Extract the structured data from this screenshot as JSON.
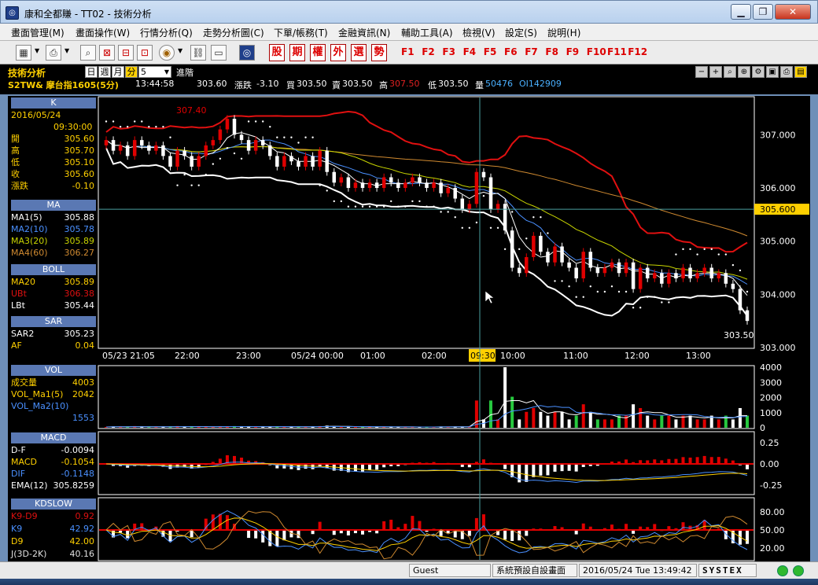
{
  "window": {
    "title": "康和全都賺 - TT02 - 技術分析",
    "min": "▁",
    "max": "❐",
    "close": "✕"
  },
  "menu": [
    "畫面管理(M)",
    "畫面操作(W)",
    "行情分析(Q)",
    "走勢分析圖(C)",
    "下單/帳務(T)",
    "金融資訊(N)",
    "輔助工具(A)",
    "檢視(V)",
    "設定(S)",
    "說明(H)"
  ],
  "toolbar": {
    "quick_buttons": [
      "股",
      "期",
      "權",
      "外",
      "選",
      "勢"
    ],
    "fkeys": [
      "F1",
      "F2",
      "F3",
      "F4",
      "F5",
      "F6",
      "F7",
      "F8",
      "F9",
      "F10",
      "F11",
      "F12"
    ]
  },
  "info": {
    "panel_title": "技術分析",
    "periods": [
      "日",
      "週",
      "月",
      "分"
    ],
    "period_value": "5",
    "advanced": "進階",
    "symbol": "S2TW& 摩台指1605(5分)",
    "time": "13:44:58",
    "price": "303.60",
    "change_label": "漲跌",
    "change": "-3.10",
    "buy_label": "買",
    "buy": "303.50",
    "sell_label": "賣",
    "sell": "303.50",
    "high_label": "高",
    "high": "307.50",
    "low_label": "低",
    "low": "303.50",
    "volume_label": "量",
    "volume": "50476",
    "oi": "OI142909"
  },
  "side": {
    "k": {
      "title": "K",
      "date": "2016/05/24",
      "time": "09:30:00",
      "rows": [
        [
          "開",
          "305.60"
        ],
        [
          "高",
          "305.70"
        ],
        [
          "低",
          "305.10"
        ],
        [
          "收",
          "305.60"
        ],
        [
          "漲跌",
          "-0.10"
        ]
      ]
    },
    "ma": {
      "title": "MA",
      "rows": [
        [
          "MA1(5)",
          "305.88"
        ],
        [
          "MA2(10)",
          "305.78"
        ],
        [
          "MA3(20)",
          "305.89"
        ],
        [
          "MA4(60)",
          "306.27"
        ]
      ]
    },
    "boll": {
      "title": "BOLL",
      "rows": [
        [
          "MA20",
          "305.89"
        ],
        [
          "UBt",
          "306.38"
        ],
        [
          "LBt",
          "305.44"
        ]
      ]
    },
    "sar": {
      "title": "SAR",
      "rows": [
        [
          "SAR2",
          "305.23"
        ],
        [
          "AF",
          "0.04"
        ]
      ]
    },
    "vol": {
      "title": "VOL",
      "rows": [
        [
          "成交量",
          "4003"
        ],
        [
          "VOL_Ma1(5)",
          "2042"
        ],
        [
          "VOL_Ma2(10)",
          ""
        ],
        [
          "",
          "1553"
        ]
      ]
    },
    "macd": {
      "title": "MACD",
      "rows": [
        [
          "D-F",
          "-0.0094"
        ],
        [
          "MACD",
          "-0.1054"
        ],
        [
          "DIF",
          "-0.1148"
        ],
        [
          "EMA(12)",
          "305.8259"
        ]
      ]
    },
    "kd": {
      "title": "KDSLOW",
      "rows": [
        [
          "K9-D9",
          "0.92"
        ],
        [
          "K9",
          "42.92"
        ],
        [
          "D9",
          "42.00"
        ],
        [
          "J(3D-2K)",
          "40.16"
        ]
      ]
    }
  },
  "colors": {
    "up": "#e00000",
    "down": "#ffffff",
    "boll_upper": "#e01010",
    "boll_lower": "#ffffff",
    "ma5": "#ffffff",
    "ma10": "#4a90ff",
    "ma20": "#c8d400",
    "ma60": "#d08a30",
    "sar": "#ffffff",
    "crosshair": "#4aa0a0",
    "accent": "#ffd000"
  },
  "chart_data": {
    "type": "candlestick",
    "price_axis": {
      "ticks": [
        "307.000",
        "306.000",
        "305.000",
        "304.000",
        "303.000"
      ],
      "ylim": [
        303.0,
        307.7
      ]
    },
    "time_labels": [
      "05/23 21:05",
      "22:00",
      "23:00",
      "05/24 00:00",
      "01:00",
      "02:00",
      "09:30",
      "10:00",
      "11:00",
      "12:00",
      "13:00"
    ],
    "crosshair_time": "09:30",
    "crosshair_price": "305.600",
    "max_label": "307.40",
    "last_label": "303.50",
    "vol_axis": {
      "ticks": [
        "4000",
        "3000",
        "2000",
        "1000",
        "0"
      ],
      "ylim": [
        0,
        4000
      ]
    },
    "macd_axis": {
      "ticks": [
        "0.25",
        "0.00",
        "-0.25"
      ],
      "ylim": [
        -0.35,
        0.35
      ]
    },
    "kd_axis": {
      "ticks": [
        "80.00",
        "50.00",
        "20.00"
      ],
      "ylim": [
        0,
        100
      ]
    },
    "candles": [
      {
        "o": 306.8,
        "c": 306.9
      },
      {
        "o": 306.9,
        "c": 306.7
      },
      {
        "o": 306.7,
        "c": 306.8
      },
      {
        "o": 306.8,
        "c": 306.6
      },
      {
        "o": 306.6,
        "c": 306.9
      },
      {
        "o": 306.9,
        "c": 306.8
      },
      {
        "o": 306.8,
        "c": 306.7
      },
      {
        "o": 306.7,
        "c": 306.8
      },
      {
        "o": 306.8,
        "c": 306.6
      },
      {
        "o": 306.6,
        "c": 306.4
      },
      {
        "o": 306.4,
        "c": 306.7
      },
      {
        "o": 306.7,
        "c": 306.6
      },
      {
        "o": 306.6,
        "c": 306.4
      },
      {
        "o": 306.4,
        "c": 306.6
      },
      {
        "o": 306.6,
        "c": 306.8
      },
      {
        "o": 306.8,
        "c": 306.9
      },
      {
        "o": 306.9,
        "c": 307.1
      },
      {
        "o": 307.1,
        "c": 307.3
      },
      {
        "o": 307.3,
        "c": 307.0
      },
      {
        "o": 307.0,
        "c": 306.9
      },
      {
        "o": 306.9,
        "c": 306.7
      },
      {
        "o": 306.7,
        "c": 306.9
      },
      {
        "o": 306.9,
        "c": 306.8
      },
      {
        "o": 306.8,
        "c": 306.6
      },
      {
        "o": 306.6,
        "c": 306.4
      },
      {
        "o": 306.4,
        "c": 306.6
      },
      {
        "o": 306.6,
        "c": 306.5
      },
      {
        "o": 306.5,
        "c": 306.4
      },
      {
        "o": 306.4,
        "c": 306.6
      },
      {
        "o": 306.6,
        "c": 306.4
      },
      {
        "o": 306.4,
        "c": 306.7
      },
      {
        "o": 306.7,
        "c": 306.3
      },
      {
        "o": 306.3,
        "c": 306.1
      },
      {
        "o": 306.1,
        "c": 306.2
      },
      {
        "o": 306.2,
        "c": 306.0
      },
      {
        "o": 306.0,
        "c": 306.1
      },
      {
        "o": 306.1,
        "c": 306.0
      },
      {
        "o": 306.0,
        "c": 306.1
      },
      {
        "o": 306.1,
        "c": 306.0
      },
      {
        "o": 306.0,
        "c": 306.2
      },
      {
        "o": 306.2,
        "c": 306.1
      },
      {
        "o": 306.1,
        "c": 306.0
      },
      {
        "o": 306.0,
        "c": 306.1
      },
      {
        "o": 306.1,
        "c": 306.2
      },
      {
        "o": 306.2,
        "c": 306.1
      },
      {
        "o": 306.1,
        "c": 306.0
      },
      {
        "o": 306.0,
        "c": 306.1
      },
      {
        "o": 306.1,
        "c": 305.9
      },
      {
        "o": 305.9,
        "c": 306.0
      },
      {
        "o": 306.0,
        "c": 305.8
      },
      {
        "o": 305.8,
        "c": 305.6
      },
      {
        "o": 305.6,
        "c": 305.7
      },
      {
        "o": 305.7,
        "c": 306.3
      },
      {
        "o": 306.3,
        "c": 306.2
      },
      {
        "o": 306.2,
        "c": 305.6
      },
      {
        "o": 305.6,
        "c": 305.7
      },
      {
        "o": 305.7,
        "c": 305.2
      },
      {
        "o": 305.2,
        "c": 304.5
      },
      {
        "o": 304.5,
        "c": 304.4
      },
      {
        "o": 304.4,
        "c": 304.7
      },
      {
        "o": 304.7,
        "c": 305.1
      },
      {
        "o": 305.1,
        "c": 304.8
      },
      {
        "o": 304.8,
        "c": 304.6
      },
      {
        "o": 304.6,
        "c": 304.9
      },
      {
        "o": 304.9,
        "c": 304.6
      },
      {
        "o": 304.6,
        "c": 304.5
      },
      {
        "o": 304.5,
        "c": 304.3
      },
      {
        "o": 304.3,
        "c": 304.8
      },
      {
        "o": 304.8,
        "c": 304.5
      },
      {
        "o": 304.5,
        "c": 304.4
      },
      {
        "o": 304.4,
        "c": 304.5
      },
      {
        "o": 304.5,
        "c": 304.6
      },
      {
        "o": 304.6,
        "c": 304.4
      },
      {
        "o": 304.4,
        "c": 304.6
      },
      {
        "o": 304.6,
        "c": 304.1
      },
      {
        "o": 304.1,
        "c": 304.5
      },
      {
        "o": 304.5,
        "c": 304.3
      },
      {
        "o": 304.3,
        "c": 304.4
      },
      {
        "o": 304.4,
        "c": 304.2
      },
      {
        "o": 304.2,
        "c": 304.4
      },
      {
        "o": 304.4,
        "c": 304.3
      },
      {
        "o": 304.3,
        "c": 304.5
      },
      {
        "o": 304.5,
        "c": 304.3
      },
      {
        "o": 304.3,
        "c": 304.4
      },
      {
        "o": 304.4,
        "c": 304.5
      },
      {
        "o": 304.5,
        "c": 304.3
      },
      {
        "o": 304.3,
        "c": 304.4
      },
      {
        "o": 304.4,
        "c": 304.2
      },
      {
        "o": 304.2,
        "c": 304.1
      },
      {
        "o": 304.1,
        "c": 303.7
      },
      {
        "o": 303.7,
        "c": 303.5
      }
    ]
  },
  "status": {
    "user": "Guest",
    "layout": "系統預設自設畫面",
    "datetime": "2016/05/24 Tue 13:49:42",
    "brand": "SYSTEX"
  }
}
